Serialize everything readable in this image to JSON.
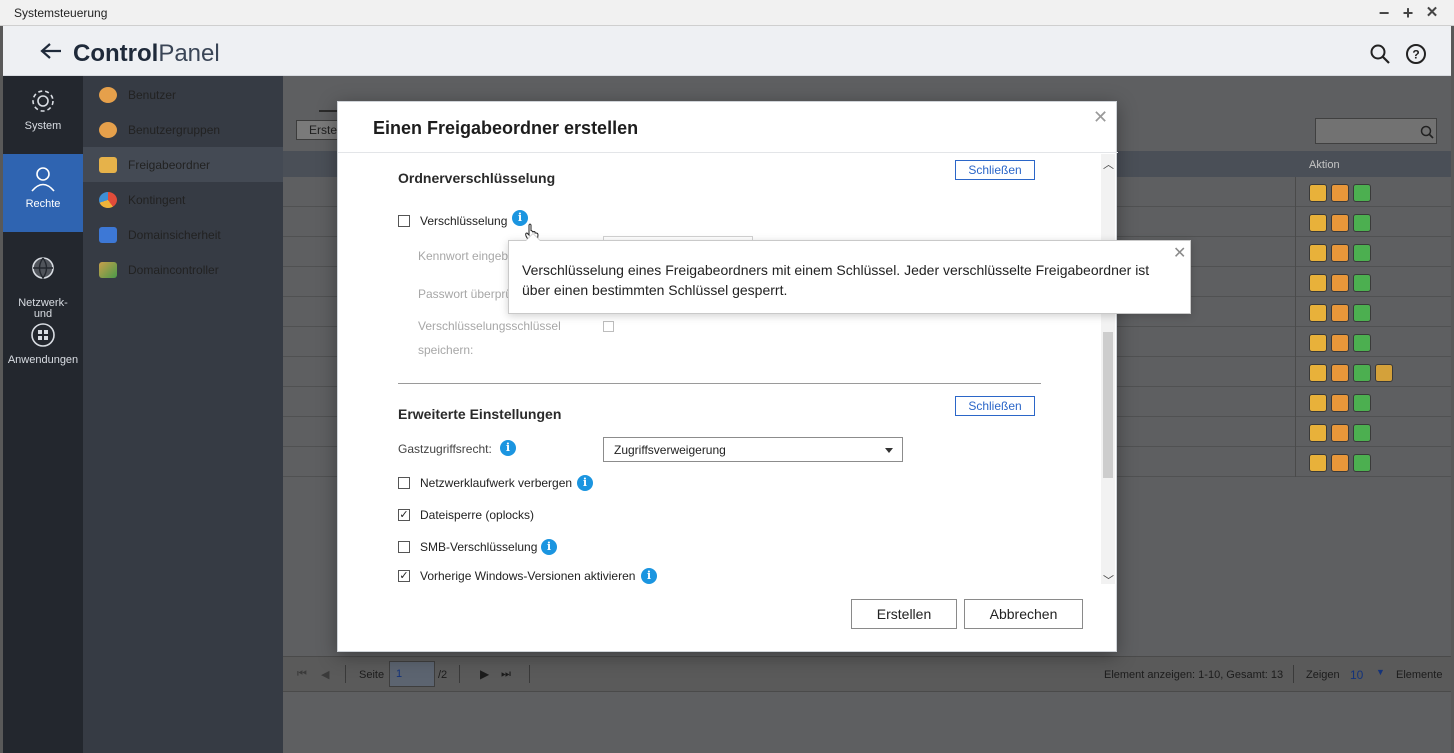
{
  "window": {
    "title": "Systemsteuerung",
    "minimize": "−",
    "maximize": "+",
    "close": "✕"
  },
  "header": {
    "title_bold": "Control",
    "title_light": "Panel"
  },
  "rail": {
    "items": [
      "System",
      "Rechte",
      "Netzwerk-\nund",
      "Anwendungen"
    ]
  },
  "sidebar": {
    "items": [
      {
        "label": "Benutzer",
        "color": "#e6a04b"
      },
      {
        "label": "Benutzergruppen",
        "color": "#e6a04b"
      },
      {
        "label": "Freigabeordner",
        "color": "#e6b24a"
      },
      {
        "label": "Kontingent",
        "color": "#e14c3a"
      },
      {
        "label": "Domainsicherheit",
        "color": "#3d78d6"
      },
      {
        "label": "Domaincontroller",
        "color": "#c9a04a"
      }
    ]
  },
  "main": {
    "button_partial": "Erste",
    "table_header_action": "Aktion",
    "pager": {
      "page_label": "Seite",
      "page_value": "1",
      "page_total": "/2",
      "summary": "Element anzeigen: 1-10, Gesamt: 13",
      "show_label": "Zeigen",
      "show_value": "10",
      "items_label": "Elemente"
    }
  },
  "modal": {
    "title": "Einen Freigabeordner erstellen",
    "section_encryption": {
      "heading": "Ordnerverschlüsselung",
      "close_label": "Schließen",
      "encrypt_label": "Verschlüsselung",
      "password_label": "Kennwort eingeb",
      "confirm_label": "Passwort überprü",
      "save_key_label_line1": "Verschlüsselungsschlüssel",
      "save_key_label_line2": "speichern:"
    },
    "section_advanced": {
      "heading": "Erweiterte Einstellungen",
      "close_label": "Schließen",
      "guest_label": "Gastzugriffsrecht:",
      "guest_value": "Zugriffsverweigerung",
      "options": [
        {
          "label": "Netzwerklaufwerk verbergen",
          "checked": false,
          "info": true
        },
        {
          "label": "Dateisperre (oplocks)",
          "checked": true,
          "info": false
        },
        {
          "label": "SMB-Verschlüsselung",
          "checked": false,
          "info": true
        },
        {
          "label": "Vorherige Windows-Versionen aktivieren",
          "checked": true,
          "info": true
        }
      ]
    },
    "create_label": "Erstellen",
    "cancel_label": "Abbrechen"
  },
  "tooltip": {
    "text": "Verschlüsselung eines Freigabeordners mit einem Schlüssel. Jeder verschlüsselte Freigabeordner ist über einen bestimmten Schlüssel gesperrt."
  },
  "colors": {
    "accent": "#2b66c8",
    "info": "#1b95e0",
    "rail_active": "#2f64b1"
  }
}
